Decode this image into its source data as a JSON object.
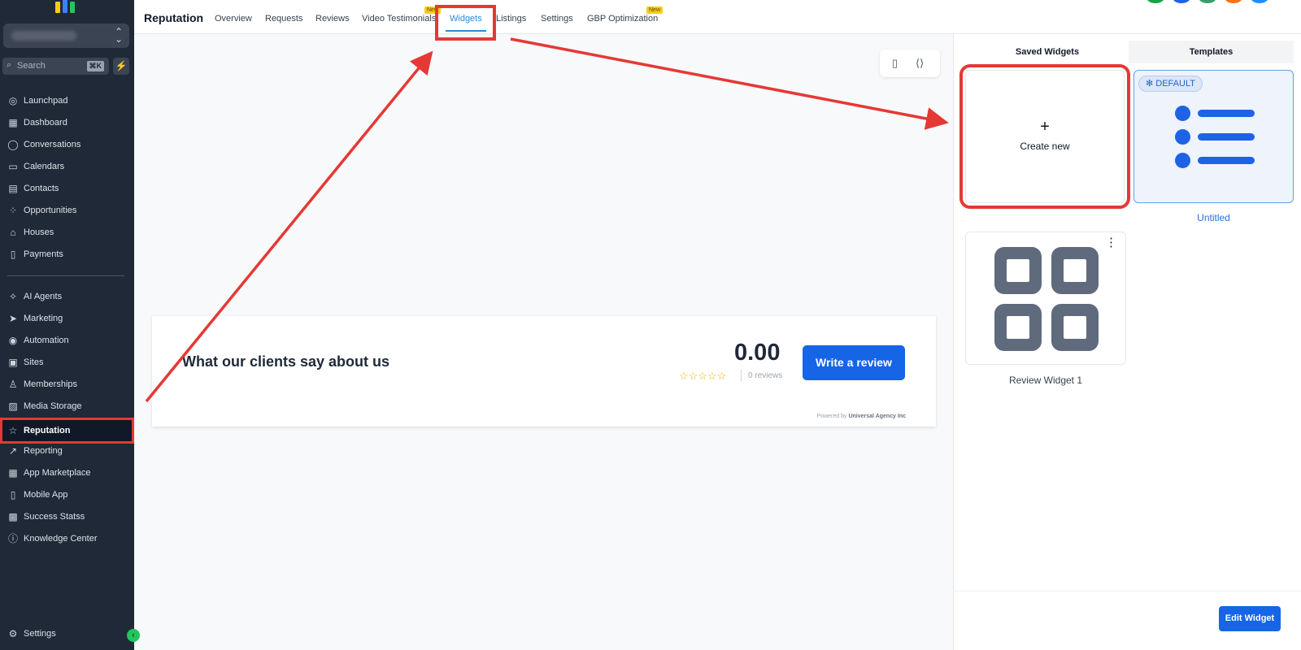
{
  "sidebar": {
    "search_placeholder": "Search",
    "search_shortcut": "⌘K",
    "items_top": [
      {
        "label": "Launchpad",
        "icon": "rocket-icon"
      },
      {
        "label": "Dashboard",
        "icon": "grid-icon"
      },
      {
        "label": "Conversations",
        "icon": "chat-icon"
      },
      {
        "label": "Calendars",
        "icon": "calendar-icon"
      },
      {
        "label": "Contacts",
        "icon": "contacts-icon"
      },
      {
        "label": "Opportunities",
        "icon": "opportunities-icon"
      },
      {
        "label": "Houses",
        "icon": "house-icon"
      },
      {
        "label": "Payments",
        "icon": "receipt-icon"
      }
    ],
    "items_bottom": [
      {
        "label": "AI Agents",
        "icon": "sparkle-icon"
      },
      {
        "label": "Marketing",
        "icon": "send-icon"
      },
      {
        "label": "Automation",
        "icon": "automation-icon"
      },
      {
        "label": "Sites",
        "icon": "sites-icon"
      },
      {
        "label": "Memberships",
        "icon": "membership-icon"
      },
      {
        "label": "Media Storage",
        "icon": "image-icon"
      },
      {
        "label": "Reputation",
        "icon": "star-icon",
        "active": true
      },
      {
        "label": "Reporting",
        "icon": "trend-icon"
      },
      {
        "label": "App Marketplace",
        "icon": "apps-icon"
      },
      {
        "label": "Mobile App",
        "icon": "phone-icon"
      },
      {
        "label": "Success Statss",
        "icon": "chart-icon"
      },
      {
        "label": "Knowledge Center",
        "icon": "info-icon"
      }
    ],
    "settings_label": "Settings"
  },
  "header": {
    "title": "Reputation",
    "tabs": [
      {
        "label": "Overview"
      },
      {
        "label": "Requests"
      },
      {
        "label": "Reviews"
      },
      {
        "label": "Video Testimonials",
        "badge": "New"
      },
      {
        "label": "Widgets",
        "active": true
      },
      {
        "label": "Listings"
      },
      {
        "label": "Settings"
      },
      {
        "label": "GBP Optimization",
        "badge": "New"
      }
    ]
  },
  "preview": {
    "heading": "What our clients say about us",
    "score": "0.00",
    "stars": "☆☆☆☆☆",
    "review_count": "0 reviews",
    "cta_label": "Write a review",
    "powered_by_prefix": "Powered by",
    "powered_by_name": "Universal Agency Inc"
  },
  "right_panel": {
    "tabs": [
      "Saved Widgets",
      "Templates"
    ],
    "create_new_label": "Create new",
    "default_badge": "DEFAULT",
    "template_name": "Untitled",
    "widget_name": "Review Widget 1",
    "edit_button": "Edit Widget"
  },
  "colors": {
    "sidebar_bg": "#1f2937",
    "accent_blue": "#1565e6",
    "highlight_red": "#e53935",
    "active_tab": "#2d8bd6"
  }
}
